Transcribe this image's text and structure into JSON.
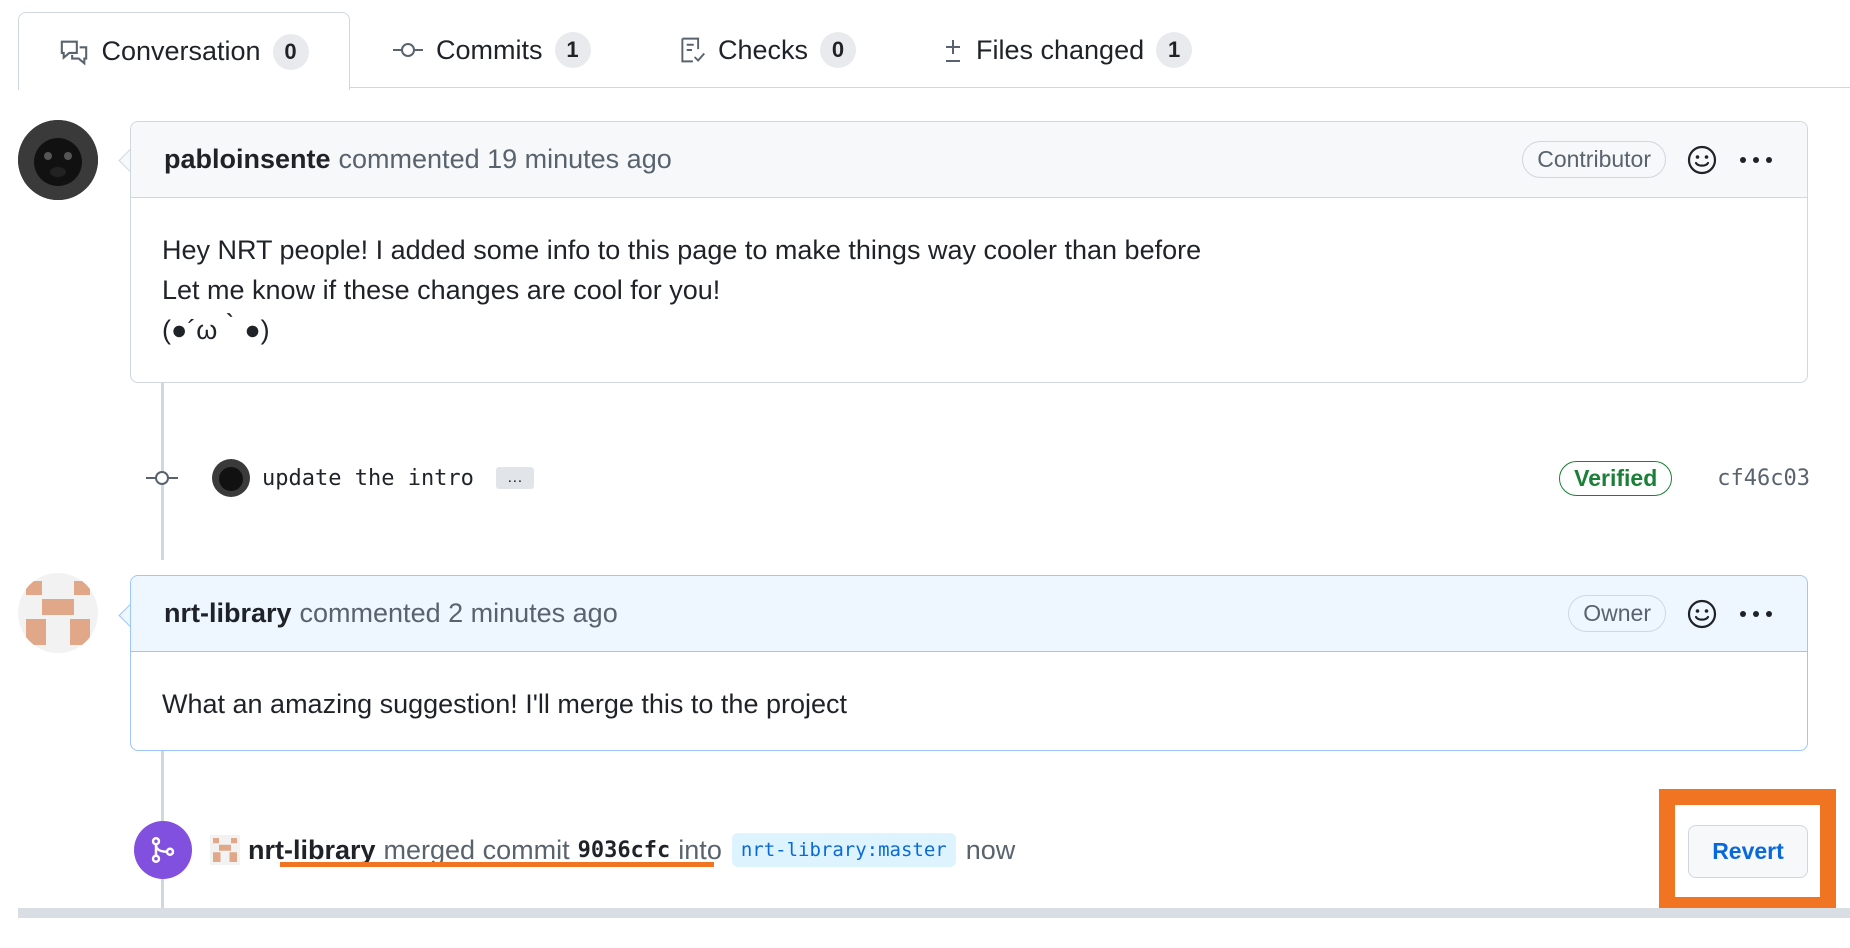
{
  "tabs": [
    {
      "label": "Conversation",
      "count": "0",
      "icon": "comment-discussion-icon"
    },
    {
      "label": "Commits",
      "count": "1",
      "icon": "git-commit-icon"
    },
    {
      "label": "Checks",
      "count": "0",
      "icon": "checklist-icon"
    },
    {
      "label": "Files changed",
      "count": "1",
      "icon": "file-diff-icon"
    }
  ],
  "comments": [
    {
      "author": "pabloinsente",
      "meta": "commented 19 minutes ago",
      "role": "Contributor",
      "lines": [
        "Hey NRT people! I added some info to this page to make things way cooler than before",
        "Let me know if these changes are cool for you!",
        "(●´ω｀●)"
      ]
    },
    {
      "author": "nrt-library",
      "meta": "commented 2 minutes ago",
      "role": "Owner",
      "lines": [
        "What an amazing suggestion! I'll merge this to the project"
      ]
    }
  ],
  "commit": {
    "message": "update the intro",
    "ellipsis": "…",
    "verified": "Verified",
    "sha": "cf46c03"
  },
  "merge": {
    "author": "nrt-library",
    "text_merged": "merged commit",
    "sha": "9036cfc",
    "text_into": "into",
    "branch": "nrt-library:master",
    "time": "now",
    "revert_label": "Revert"
  },
  "colors": {
    "accent": "#0969da",
    "merged": "#8250df",
    "verified": "#1a7f37",
    "highlight": "#f07421"
  }
}
